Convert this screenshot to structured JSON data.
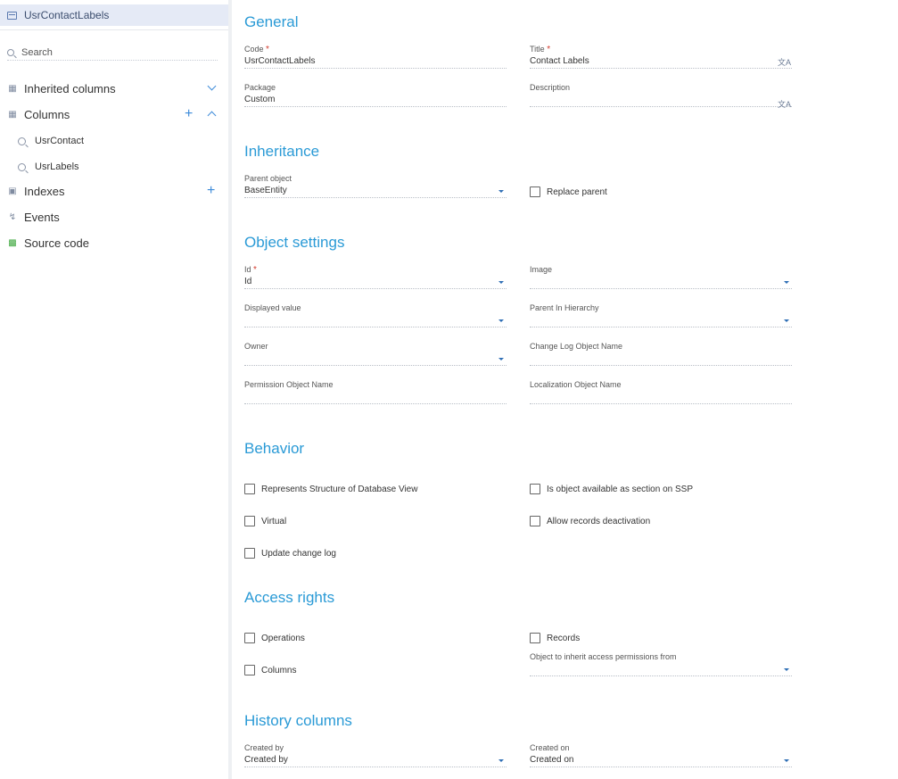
{
  "sidebar": {
    "object_name": "UsrContactLabels",
    "search_placeholder": "Search",
    "items": {
      "inherited_columns": "Inherited columns",
      "columns": "Columns",
      "indexes": "Indexes",
      "events": "Events",
      "source_code": "Source code"
    },
    "columns_list": [
      "UsrContact",
      "UsrLabels"
    ]
  },
  "general": {
    "title": "General",
    "code_label": "Code",
    "code_value": "UsrContactLabels",
    "title_label": "Title",
    "title_value": "Contact Labels",
    "package_label": "Package",
    "package_value": "Custom",
    "description_label": "Description",
    "description_value": ""
  },
  "inheritance": {
    "title": "Inheritance",
    "parent_label": "Parent object",
    "parent_value": "BaseEntity",
    "replace_parent": "Replace parent"
  },
  "object_settings": {
    "title": "Object settings",
    "id_label": "Id",
    "id_value": "Id",
    "image_label": "Image",
    "displayed_label": "Displayed value",
    "parent_hierarchy_label": "Parent In Hierarchy",
    "owner_label": "Owner",
    "change_log_label": "Change Log Object Name",
    "permission_label": "Permission Object Name",
    "localization_label": "Localization Object Name"
  },
  "behavior": {
    "title": "Behavior",
    "represents_db_view": "Represents Structure of Database View",
    "available_ssp": "Is object available as section on SSP",
    "virtual": "Virtual",
    "allow_deactivation": "Allow records deactivation",
    "update_change_log": "Update change log"
  },
  "access_rights": {
    "title": "Access rights",
    "operations": "Operations",
    "records": "Records",
    "columns": "Columns",
    "inherit_label": "Object to inherit access permissions from"
  },
  "history": {
    "title": "History columns",
    "created_by_label": "Created by",
    "created_by_value": "Created by",
    "created_on_label": "Created on",
    "created_on_value": "Created on"
  },
  "colors": {
    "accent": "#2a9ad6",
    "selected_bg": "#e5eaf6",
    "required": "#d23b2e"
  }
}
